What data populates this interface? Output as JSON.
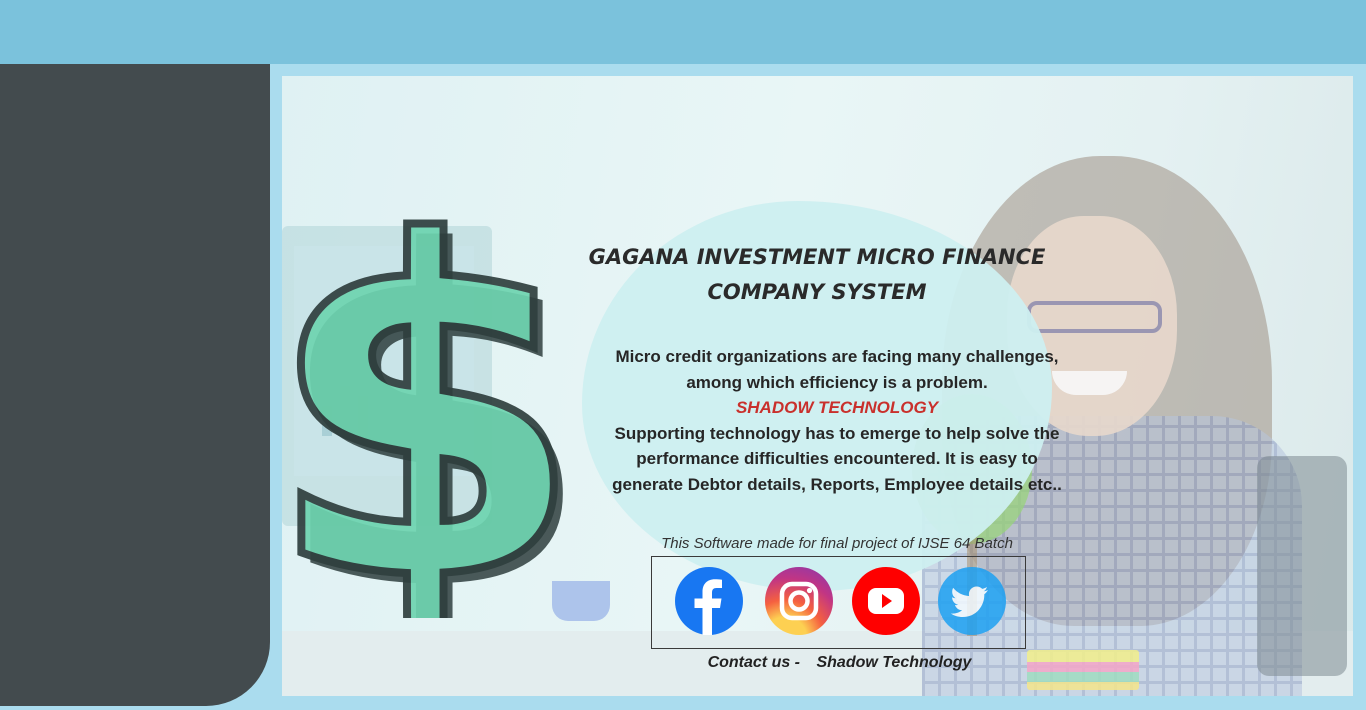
{
  "app": {
    "title": "GAGANA INVESTMENT MICRO FINANCE COMPANY SYSTEM"
  },
  "intro": {
    "title_line1": "GAGANA INVESTMENT MICRO FINANCE",
    "title_line2": "COMPANY SYSTEM",
    "line1": "Micro credit organizations are facing many challenges,",
    "line2": "among which efficiency is a problem.",
    "brand": "SHADOW TECHNOLOGY",
    "line3": "Supporting technology has to emerge to help solve the",
    "line4": "performance difficulties encountered. It is easy to",
    "line5": "generate Debtor details, Reports, Employee details etc.."
  },
  "footer": {
    "credit": "This Software made for final project of IJSE 64 Batch",
    "contact_label": "Contact us -",
    "contact_name": "Shadow Technology"
  },
  "social": [
    {
      "name": "facebook-icon",
      "color": "#1877f2"
    },
    {
      "name": "instagram-icon",
      "color": "#c13584"
    },
    {
      "name": "youtube-icon",
      "color": "#ff0000"
    },
    {
      "name": "twitter-icon",
      "color": "#1da1f2"
    }
  ],
  "colors": {
    "topbar": "#7bc2dc",
    "sidebar": "#434b4e",
    "brand_red": "#c9302c",
    "dollar_green": "#6ed4b0"
  }
}
